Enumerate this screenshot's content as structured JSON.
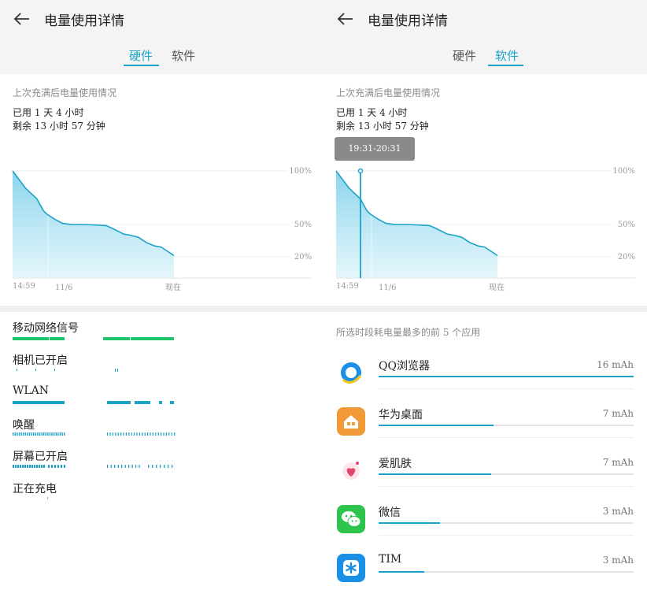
{
  "page": {
    "title": "电量使用详情"
  },
  "tabs": [
    "硬件",
    "软件"
  ],
  "summary": {
    "caption": "上次充满后电量使用情况",
    "used": "已用 1 天 4 小时",
    "remaining": "剩余 13 小时 57 分钟"
  },
  "chart_data": {
    "type": "area",
    "y_tick_labels": [
      "100%",
      "50%",
      "20%"
    ],
    "x_tick_labels": [
      "14:59",
      "11/6",
      "现在"
    ],
    "ylim": [
      0,
      100
    ],
    "x": [
      0,
      0.04,
      0.08,
      0.15,
      0.19,
      0.21,
      0.26,
      0.31,
      0.37,
      0.45,
      0.52,
      0.58,
      0.61,
      0.65,
      0.69,
      0.73,
      0.78,
      0.83,
      0.88,
      0.92,
      0.96,
      1.0
    ],
    "values": [
      100,
      92,
      84,
      74,
      63,
      60,
      55,
      51,
      50,
      50,
      49.5,
      49,
      47,
      44,
      41,
      40,
      38,
      33,
      30,
      29,
      25,
      21
    ],
    "color": "#1aa3c7",
    "selected_range": "19:31-20:31"
  },
  "hardware": [
    {
      "label": "移动网络信号"
    },
    {
      "label": "相机已开启"
    },
    {
      "label": "WLAN"
    },
    {
      "label": "唤醒"
    },
    {
      "label": "屏幕已开启"
    },
    {
      "label": "正在充电"
    }
  ],
  "apps_caption": "所选时段耗电量最多的前 5 个应用",
  "apps": [
    {
      "name": "QQ浏览器",
      "value": "16 mAh",
      "icon": "qq-browser-icon",
      "color": "#1b8fe6",
      "fill_pct": 100
    },
    {
      "name": "华为桌面",
      "value": "7 mAh",
      "icon": "home-icon",
      "color": "#f29a38",
      "fill_pct": 45
    },
    {
      "name": "爱肌肤",
      "value": "7 mAh",
      "icon": "flower-icon",
      "color": "#e2446a",
      "fill_pct": 44
    },
    {
      "name": "微信",
      "value": "3 mAh",
      "icon": "wechat-icon",
      "color": "#2cc44a",
      "fill_pct": 24
    },
    {
      "name": "TIM",
      "value": "3 mAh",
      "icon": "tim-icon",
      "color": "#1a8fe6",
      "fill_pct": 18
    }
  ],
  "colors": {
    "accent": "#1aa3c7",
    "green": "#1fc56a",
    "header_bg": "#f4f4f4"
  }
}
